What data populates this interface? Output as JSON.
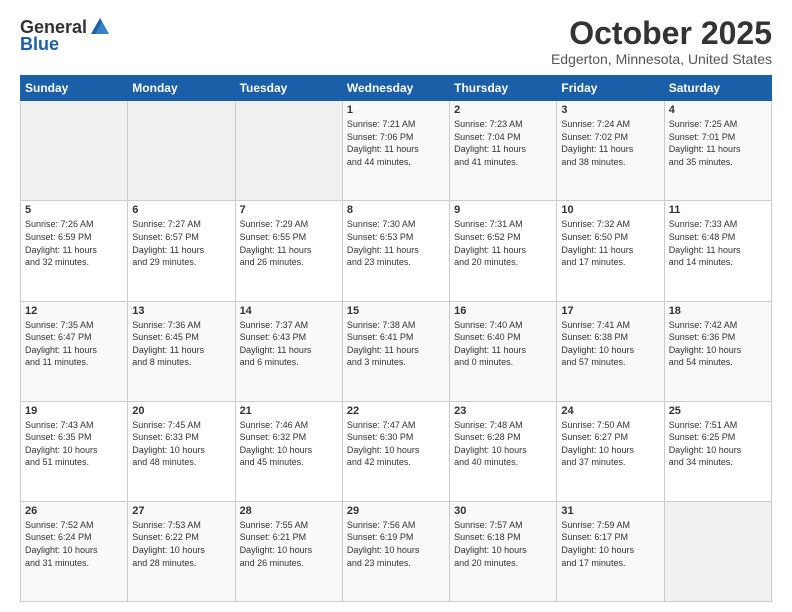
{
  "header": {
    "logo_general": "General",
    "logo_blue": "Blue",
    "month_title": "October 2025",
    "location": "Edgerton, Minnesota, United States"
  },
  "days_of_week": [
    "Sunday",
    "Monday",
    "Tuesday",
    "Wednesday",
    "Thursday",
    "Friday",
    "Saturday"
  ],
  "weeks": [
    [
      {
        "day": "",
        "info": ""
      },
      {
        "day": "",
        "info": ""
      },
      {
        "day": "",
        "info": ""
      },
      {
        "day": "1",
        "info": "Sunrise: 7:21 AM\nSunset: 7:06 PM\nDaylight: 11 hours\nand 44 minutes."
      },
      {
        "day": "2",
        "info": "Sunrise: 7:23 AM\nSunset: 7:04 PM\nDaylight: 11 hours\nand 41 minutes."
      },
      {
        "day": "3",
        "info": "Sunrise: 7:24 AM\nSunset: 7:02 PM\nDaylight: 11 hours\nand 38 minutes."
      },
      {
        "day": "4",
        "info": "Sunrise: 7:25 AM\nSunset: 7:01 PM\nDaylight: 11 hours\nand 35 minutes."
      }
    ],
    [
      {
        "day": "5",
        "info": "Sunrise: 7:26 AM\nSunset: 6:59 PM\nDaylight: 11 hours\nand 32 minutes."
      },
      {
        "day": "6",
        "info": "Sunrise: 7:27 AM\nSunset: 6:57 PM\nDaylight: 11 hours\nand 29 minutes."
      },
      {
        "day": "7",
        "info": "Sunrise: 7:29 AM\nSunset: 6:55 PM\nDaylight: 11 hours\nand 26 minutes."
      },
      {
        "day": "8",
        "info": "Sunrise: 7:30 AM\nSunset: 6:53 PM\nDaylight: 11 hours\nand 23 minutes."
      },
      {
        "day": "9",
        "info": "Sunrise: 7:31 AM\nSunset: 6:52 PM\nDaylight: 11 hours\nand 20 minutes."
      },
      {
        "day": "10",
        "info": "Sunrise: 7:32 AM\nSunset: 6:50 PM\nDaylight: 11 hours\nand 17 minutes."
      },
      {
        "day": "11",
        "info": "Sunrise: 7:33 AM\nSunset: 6:48 PM\nDaylight: 11 hours\nand 14 minutes."
      }
    ],
    [
      {
        "day": "12",
        "info": "Sunrise: 7:35 AM\nSunset: 6:47 PM\nDaylight: 11 hours\nand 11 minutes."
      },
      {
        "day": "13",
        "info": "Sunrise: 7:36 AM\nSunset: 6:45 PM\nDaylight: 11 hours\nand 8 minutes."
      },
      {
        "day": "14",
        "info": "Sunrise: 7:37 AM\nSunset: 6:43 PM\nDaylight: 11 hours\nand 6 minutes."
      },
      {
        "day": "15",
        "info": "Sunrise: 7:38 AM\nSunset: 6:41 PM\nDaylight: 11 hours\nand 3 minutes."
      },
      {
        "day": "16",
        "info": "Sunrise: 7:40 AM\nSunset: 6:40 PM\nDaylight: 11 hours\nand 0 minutes."
      },
      {
        "day": "17",
        "info": "Sunrise: 7:41 AM\nSunset: 6:38 PM\nDaylight: 10 hours\nand 57 minutes."
      },
      {
        "day": "18",
        "info": "Sunrise: 7:42 AM\nSunset: 6:36 PM\nDaylight: 10 hours\nand 54 minutes."
      }
    ],
    [
      {
        "day": "19",
        "info": "Sunrise: 7:43 AM\nSunset: 6:35 PM\nDaylight: 10 hours\nand 51 minutes."
      },
      {
        "day": "20",
        "info": "Sunrise: 7:45 AM\nSunset: 6:33 PM\nDaylight: 10 hours\nand 48 minutes."
      },
      {
        "day": "21",
        "info": "Sunrise: 7:46 AM\nSunset: 6:32 PM\nDaylight: 10 hours\nand 45 minutes."
      },
      {
        "day": "22",
        "info": "Sunrise: 7:47 AM\nSunset: 6:30 PM\nDaylight: 10 hours\nand 42 minutes."
      },
      {
        "day": "23",
        "info": "Sunrise: 7:48 AM\nSunset: 6:28 PM\nDaylight: 10 hours\nand 40 minutes."
      },
      {
        "day": "24",
        "info": "Sunrise: 7:50 AM\nSunset: 6:27 PM\nDaylight: 10 hours\nand 37 minutes."
      },
      {
        "day": "25",
        "info": "Sunrise: 7:51 AM\nSunset: 6:25 PM\nDaylight: 10 hours\nand 34 minutes."
      }
    ],
    [
      {
        "day": "26",
        "info": "Sunrise: 7:52 AM\nSunset: 6:24 PM\nDaylight: 10 hours\nand 31 minutes."
      },
      {
        "day": "27",
        "info": "Sunrise: 7:53 AM\nSunset: 6:22 PM\nDaylight: 10 hours\nand 28 minutes."
      },
      {
        "day": "28",
        "info": "Sunrise: 7:55 AM\nSunset: 6:21 PM\nDaylight: 10 hours\nand 26 minutes."
      },
      {
        "day": "29",
        "info": "Sunrise: 7:56 AM\nSunset: 6:19 PM\nDaylight: 10 hours\nand 23 minutes."
      },
      {
        "day": "30",
        "info": "Sunrise: 7:57 AM\nSunset: 6:18 PM\nDaylight: 10 hours\nand 20 minutes."
      },
      {
        "day": "31",
        "info": "Sunrise: 7:59 AM\nSunset: 6:17 PM\nDaylight: 10 hours\nand 17 minutes."
      },
      {
        "day": "",
        "info": ""
      }
    ]
  ]
}
